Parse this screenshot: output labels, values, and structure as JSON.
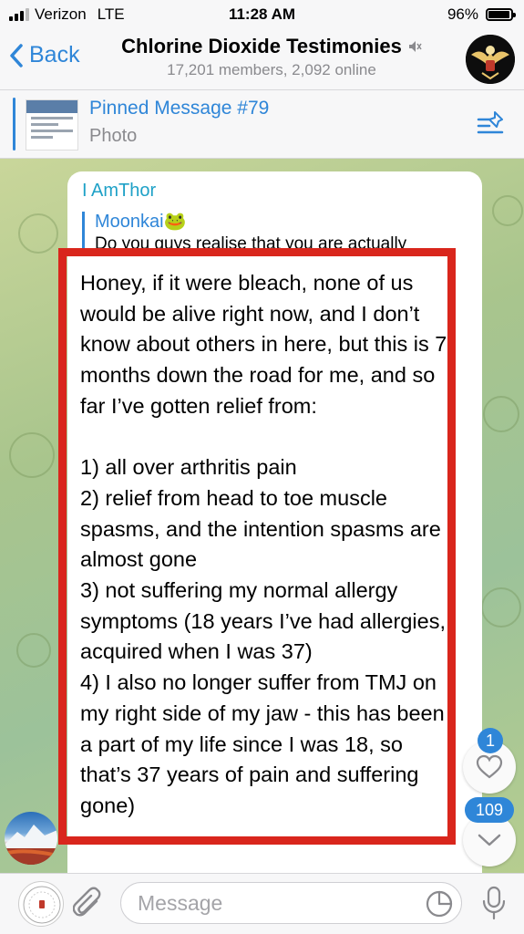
{
  "status_bar": {
    "carrier": "Verizon",
    "network": "LTE",
    "time": "11:28 AM",
    "battery": "96%",
    "battery_level": 0.96
  },
  "header": {
    "back_label": "Back",
    "title": "Chlorine Dioxide Testimonies",
    "subtitle": "17,201 members, 2,092 online",
    "muted_icon": "speaker-muted-icon"
  },
  "pinned": {
    "title": "Pinned Message #79",
    "subtitle": "Photo"
  },
  "message": {
    "sender": "I AmThor",
    "reply_to_name": "Moonkai🐸",
    "reply_to_text": "Do you guys realise that you are actually",
    "text": "Honey, if it were bleach, none of us would be alive right now, and I don’t know about others in here, but this is 7 months down the road for me, and so far I’ve gotten relief from:\n\n1) all over arthritis pain\n2) relief from head to toe muscle spasms, and the intention spasms are almost gone\n3) not suffering my normal allergy symptoms (18 years I’ve had allergies, acquired when I was 37)\n4) I also no longer suffer from TMJ on my right side of my jaw - this has been a part of my life since I was 18, so that’s 37 years of pain and suffering gone)",
    "highlight_color": "#d9261c"
  },
  "floating": {
    "reactions_badge": "1",
    "unread_badge": "109"
  },
  "input": {
    "placeholder": "Message"
  },
  "colors": {
    "accent": "#2f86d8",
    "sender_name": "#1ea1c7"
  }
}
